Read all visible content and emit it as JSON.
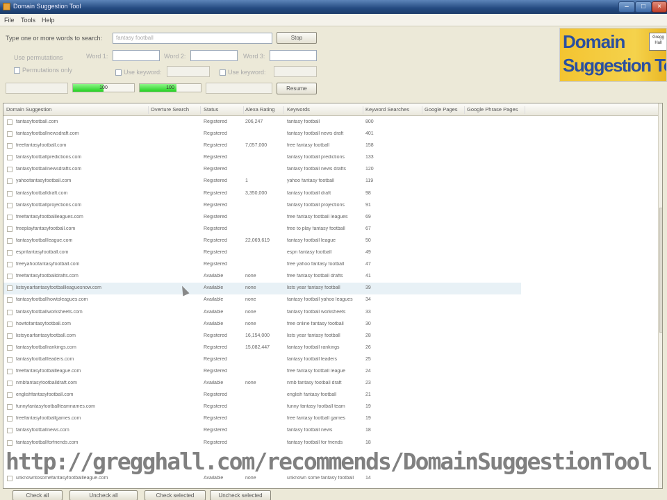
{
  "window": {
    "title": "Domain Suggestion Tool"
  },
  "menu": [
    "File",
    "Tools",
    "Help"
  ],
  "search": {
    "label": "Type one or more words to search:",
    "value": "fantasy football",
    "stop_label": "Stop",
    "use_permutations": "Use permutations",
    "permutations_only": "Permutations only",
    "word1_label": "Word 1:",
    "word2_label": "Word 2:",
    "word3_label": "Word 3:",
    "use_keyword_1": "Use keyword:",
    "use_keyword_2": "Use keyword:",
    "resume_label": "Resume"
  },
  "progress": [
    {
      "text": "100",
      "fill_fraction": 0.5
    },
    {
      "text": "100",
      "fill_fraction": 0.6
    }
  ],
  "logo": {
    "line1": "Domain",
    "line2": "Suggestion Tool",
    "badge": "Gregg Hall"
  },
  "grid": {
    "columns": [
      "Domain Suggestion",
      "Overture Search",
      "Status",
      "Alexa Rating",
      "Keywords",
      "Keyword Searches",
      "Google Pages",
      "Google Phrase Pages"
    ],
    "rows": [
      [
        "fantasyfootball.com",
        "",
        "Registered",
        "206,247",
        "fantasy football",
        "800"
      ],
      [
        "fantasyfootballnewsdraft.com",
        "",
        "Registered",
        "",
        "fantasy football news draft",
        "401"
      ],
      [
        "freefantasyfootball.com",
        "",
        "Registered",
        "7,057,000",
        "free fantasy football",
        "158"
      ],
      [
        "fantasyfootballpredictions.com",
        "",
        "Registered",
        "",
        "fantasy football predictions",
        "133"
      ],
      [
        "fantasyfootballnewsdrafts.com",
        "",
        "Registered",
        "",
        "fantasy football news drafts",
        "120"
      ],
      [
        "yahoofantasyfootball.com",
        "",
        "Registered",
        "1",
        "yahoo fantasy football",
        "119"
      ],
      [
        "fantasyfootballdraft.com",
        "",
        "Registered",
        "3,350,000",
        "fantasy football draft",
        "98"
      ],
      [
        "fantasyfootballprojections.com",
        "",
        "Registered",
        "",
        "fantasy football projections",
        "91"
      ],
      [
        "freefantasyfootballleagues.com",
        "",
        "Registered",
        "",
        "free fantasy football leagues",
        "69"
      ],
      [
        "freeplayfantasyfootball.com",
        "",
        "Registered",
        "",
        "free to play fantasy football",
        "67"
      ],
      [
        "fantasyfootballleague.com",
        "",
        "Registered",
        "22,069,619",
        "fantasy football league",
        "50"
      ],
      [
        "espnfantasyfootball.com",
        "",
        "Registered",
        "",
        "espn fantasy football",
        "49"
      ],
      [
        "freeyahoofantasyfootball.com",
        "",
        "Registered",
        "",
        "free yahoo fantasy football",
        "47"
      ],
      [
        "freefantasyfootballdrafts.com",
        "",
        "Available",
        "none",
        "free fantasy football drafts",
        "41"
      ],
      [
        "listsyearfantasyfootballleaguesnow.com",
        "",
        "Available",
        "none",
        "lists year fantasy football",
        "39"
      ],
      [
        "fantasyfootballhowtoleagues.com",
        "",
        "Available",
        "none",
        "fantasy football yahoo leagues",
        "34"
      ],
      [
        "fantasyfootballworksheets.com",
        "",
        "Available",
        "none",
        "fantasy football worksheets",
        "33"
      ],
      [
        "howtofantasyfootball.com",
        "",
        "Available",
        "none",
        "free online fantasy football",
        "30"
      ],
      [
        "listsyearfantasyfootball.com",
        "",
        "Registered",
        "16,154,000",
        "lists year fantasy football",
        "28"
      ],
      [
        "fantasyfootballrankings.com",
        "",
        "Registered",
        "15,082,447",
        "fantasy football rankings",
        "26"
      ],
      [
        "fantasyfootballleaders.com",
        "",
        "Registered",
        "",
        "fantasy football leaders",
        "25"
      ],
      [
        "freefantasyfootballleague.com",
        "",
        "Registered",
        "",
        "free fantasy football league",
        "24"
      ],
      [
        "nmbfantasyfootballdraft.com",
        "",
        "Available",
        "none",
        "nmb fantasy football draft",
        "23"
      ],
      [
        "englishfantasyfootball.com",
        "",
        "Registered",
        "",
        "english fantasy football",
        "21"
      ],
      [
        "funnyfantasyfootballteamnames.com",
        "",
        "Registered",
        "",
        "funny fantasy football team",
        "19"
      ],
      [
        "freefantasyfootballgames.com",
        "",
        "Registered",
        "",
        "free fantasy football games",
        "19"
      ],
      [
        "fantasyfootballnews.com",
        "",
        "Registered",
        "",
        "fantasy football news",
        "18"
      ],
      [
        "fantasyfootballforfriends.com",
        "",
        "Registered",
        "",
        "fantasy football for friends",
        "18"
      ],
      [
        "",
        "",
        "",
        "",
        "",
        ""
      ],
      [
        "",
        "",
        "",
        "",
        "",
        ""
      ],
      [
        "unknowntosomefantasyfootballleague.com",
        "",
        "Available",
        "none",
        "unknown some fantasy football",
        "14"
      ]
    ]
  },
  "watermark": "http://gregghall.com/recommends/DomainSuggestionTool",
  "bottom_buttons": [
    "Check all",
    "Uncheck all",
    "Check selected",
    "Uncheck selected"
  ]
}
